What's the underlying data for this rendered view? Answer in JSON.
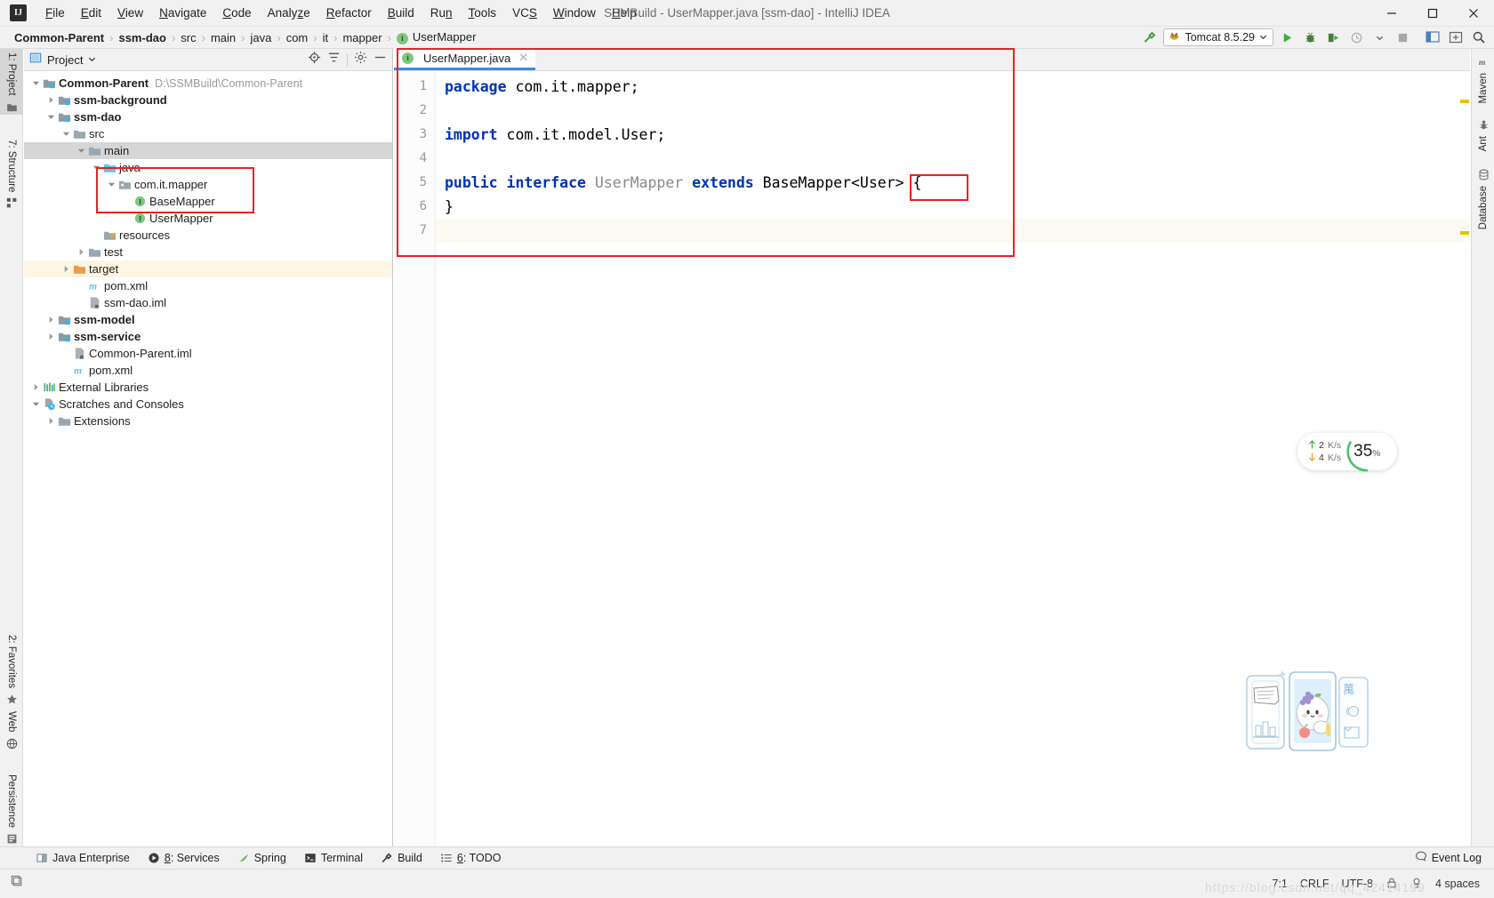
{
  "window": {
    "title": "SSMBuild - UserMapper.java [ssm-dao] - IntelliJ IDEA",
    "logo_text": "IJ",
    "minimize_label": "Minimize",
    "maximize_label": "Maximize",
    "close_label": "Close"
  },
  "menu": [
    {
      "label": "File",
      "mnemonic": "F"
    },
    {
      "label": "Edit",
      "mnemonic": "E"
    },
    {
      "label": "View",
      "mnemonic": "V"
    },
    {
      "label": "Navigate",
      "mnemonic": "N"
    },
    {
      "label": "Code",
      "mnemonic": "C"
    },
    {
      "label": "Analyze",
      "mnemonic": "z"
    },
    {
      "label": "Refactor",
      "mnemonic": "R"
    },
    {
      "label": "Build",
      "mnemonic": "B"
    },
    {
      "label": "Run",
      "mnemonic": "n"
    },
    {
      "label": "Tools",
      "mnemonic": "T"
    },
    {
      "label": "VCS",
      "mnemonic": "S"
    },
    {
      "label": "Window",
      "mnemonic": "W"
    },
    {
      "label": "Help",
      "mnemonic": "H"
    }
  ],
  "breadcrumbs": [
    {
      "label": "Common-Parent",
      "bold": true
    },
    {
      "label": "ssm-dao",
      "bold": true
    },
    {
      "label": "src",
      "bold": false
    },
    {
      "label": "main",
      "bold": false
    },
    {
      "label": "java",
      "bold": false
    },
    {
      "label": "com",
      "bold": false
    },
    {
      "label": "it",
      "bold": false
    },
    {
      "label": "mapper",
      "bold": false
    },
    {
      "label": "UserMapper",
      "bold": false,
      "badge": "I"
    }
  ],
  "toolbar": {
    "build_icon_label": "Build",
    "run_config": "Tomcat 8.5.29",
    "run_label": "Run",
    "debug_label": "Debug",
    "run_coverage_label": "Run with Coverage",
    "profile_label": "Profile",
    "stop_label": "Stop",
    "layout_label": "Layout",
    "updates_label": "Updates",
    "search_label": "Search Everywhere"
  },
  "left_strip": {
    "top": [
      {
        "label": "1: Project",
        "icon": "project-icon",
        "active": true
      },
      {
        "label": "7: Structure",
        "icon": "structure-icon",
        "active": false
      }
    ],
    "bottom": [
      {
        "label": "2: Favorites",
        "icon": "star-icon",
        "active": false
      },
      {
        "label": "Web",
        "icon": "web-icon",
        "active": false
      },
      {
        "label": "Persistence",
        "icon": "persistence-icon",
        "active": false
      }
    ]
  },
  "right_strip": [
    {
      "label": "Maven",
      "icon": "maven-icon"
    },
    {
      "label": "Ant",
      "icon": "ant-icon"
    },
    {
      "label": "Database",
      "icon": "database-icon"
    }
  ],
  "project_panel": {
    "title": "Project",
    "dropdown_icon": "chevron-down-icon",
    "locate_icon": "locate-icon",
    "collapse_icon": "collapse-all-icon",
    "settings_icon": "gear-icon",
    "hide_icon": "hide-icon",
    "tree": [
      {
        "label": "Common-Parent",
        "path": "D:\\SSMBuild\\Common-Parent",
        "indent": 0,
        "twist": "down",
        "icon": "module-icon",
        "bold": true
      },
      {
        "label": "ssm-background",
        "path": "",
        "indent": 1,
        "twist": "right",
        "icon": "module-icon",
        "bold": true
      },
      {
        "label": "ssm-dao",
        "path": "",
        "indent": 1,
        "twist": "down",
        "icon": "module-icon",
        "bold": true
      },
      {
        "label": "src",
        "path": "",
        "indent": 2,
        "twist": "down",
        "icon": "folder-icon",
        "bold": false
      },
      {
        "label": "main",
        "path": "",
        "indent": 3,
        "twist": "down",
        "icon": "folder-icon",
        "bold": false,
        "selected": true
      },
      {
        "label": "java",
        "path": "",
        "indent": 4,
        "twist": "down",
        "icon": "source-folder-icon",
        "bold": false
      },
      {
        "label": "com.it.mapper",
        "path": "",
        "indent": 5,
        "twist": "down",
        "icon": "package-icon",
        "bold": false
      },
      {
        "label": "BaseMapper",
        "path": "",
        "indent": 6,
        "twist": "none",
        "icon": "interface-icon",
        "bold": false
      },
      {
        "label": "UserMapper",
        "path": "",
        "indent": 6,
        "twist": "none",
        "icon": "interface-icon",
        "bold": false
      },
      {
        "label": "resources",
        "path": "",
        "indent": 4,
        "twist": "none",
        "icon": "resources-folder-icon",
        "bold": false
      },
      {
        "label": "test",
        "path": "",
        "indent": 3,
        "twist": "right",
        "icon": "folder-icon",
        "bold": false
      },
      {
        "label": "target",
        "path": "",
        "indent": 2,
        "twist": "right",
        "icon": "excluded-folder-icon",
        "bold": false,
        "highlight": true
      },
      {
        "label": "pom.xml",
        "path": "",
        "indent": 3,
        "twist": "none",
        "icon": "maven-file-icon",
        "bold": false
      },
      {
        "label": "ssm-dao.iml",
        "path": "",
        "indent": 3,
        "twist": "none",
        "icon": "iml-file-icon",
        "bold": false
      },
      {
        "label": "ssm-model",
        "path": "",
        "indent": 1,
        "twist": "right",
        "icon": "module-icon",
        "bold": true
      },
      {
        "label": "ssm-service",
        "path": "",
        "indent": 1,
        "twist": "right",
        "icon": "module-icon",
        "bold": true
      },
      {
        "label": "Common-Parent.iml",
        "path": "",
        "indent": 2,
        "twist": "none",
        "icon": "iml-file-icon",
        "bold": false
      },
      {
        "label": "pom.xml",
        "path": "",
        "indent": 2,
        "twist": "none",
        "icon": "maven-file-icon",
        "bold": false
      },
      {
        "label": "External Libraries",
        "path": "",
        "indent": 0,
        "twist": "right",
        "icon": "libraries-icon",
        "bold": false
      },
      {
        "label": "Scratches and Consoles",
        "path": "",
        "indent": 0,
        "twist": "down",
        "icon": "scratches-icon",
        "bold": false
      },
      {
        "label": "Extensions",
        "path": "",
        "indent": 1,
        "twist": "right",
        "icon": "folder-icon",
        "bold": false
      }
    ]
  },
  "editor": {
    "tab": {
      "label": "UserMapper.java",
      "badge": "I",
      "close_icon": "close-icon"
    },
    "hide_icon": "hide-icon",
    "lines": [
      {
        "num": "1",
        "tokens": [
          {
            "t": "package",
            "c": "kw"
          },
          {
            "t": " com.it.mapper;",
            "c": "pl"
          }
        ]
      },
      {
        "num": "2",
        "tokens": []
      },
      {
        "num": "3",
        "tokens": [
          {
            "t": "import",
            "c": "kw"
          },
          {
            "t": " com.it.model.User;",
            "c": "pl"
          }
        ]
      },
      {
        "num": "4",
        "tokens": []
      },
      {
        "num": "5",
        "tokens": [
          {
            "t": "public",
            "c": "kw"
          },
          {
            "t": " ",
            "c": "pl"
          },
          {
            "t": "interface",
            "c": "kw"
          },
          {
            "t": " ",
            "c": "pl"
          },
          {
            "t": "UserMapper",
            "c": "typ"
          },
          {
            "t": " ",
            "c": "pl"
          },
          {
            "t": "extends",
            "c": "kw"
          },
          {
            "t": " BaseMapper<User> {",
            "c": "pl"
          }
        ]
      },
      {
        "num": "6",
        "tokens": [
          {
            "t": "}",
            "c": "pl"
          }
        ]
      },
      {
        "num": "7",
        "tokens": [],
        "caret": true
      }
    ]
  },
  "annotations": {
    "tree_box_label": "mapper-package-highlight",
    "editor_box_label": "editor-region-highlight",
    "generic_box_label": "user-generic-highlight",
    "color": "#ec2024"
  },
  "network_widget": {
    "upload_value": "2",
    "upload_unit": "K/s",
    "upload_icon": "arrow-up-icon",
    "download_value": "4",
    "download_unit": "K/s",
    "download_icon": "arrow-down-icon",
    "percent": "35",
    "percent_sign": "%",
    "gauge_color": "#47c26a",
    "upload_color": "#4caf50",
    "download_color": "#f0a030"
  },
  "sticker": {
    "name": "fridge-character-sticker"
  },
  "bottom_tabs": [
    {
      "label": "Java Enterprise",
      "icon": "java-enterprise-icon",
      "mnemonic": ""
    },
    {
      "label": "8: Services",
      "icon": "services-icon",
      "mnemonic": "8"
    },
    {
      "label": "Spring",
      "icon": "spring-icon",
      "mnemonic": ""
    },
    {
      "label": "Terminal",
      "icon": "terminal-icon",
      "mnemonic": ""
    },
    {
      "label": "Build",
      "icon": "build-icon",
      "mnemonic": ""
    },
    {
      "label": "6: TODO",
      "icon": "todo-icon",
      "mnemonic": "6"
    }
  ],
  "event_log": {
    "label": "Event Log",
    "icon": "event-log-icon"
  },
  "status_bar": {
    "toggle_icon": "toggle-panels-icon",
    "position": "7:1",
    "line_sep": "CRLF",
    "encoding": "UTF-8",
    "lock_icon": "lock-icon",
    "inspection_icon": "inspection-icon",
    "indent": "4 spaces",
    "watermark": "https://blog.csdn.net/qq_42414199"
  }
}
